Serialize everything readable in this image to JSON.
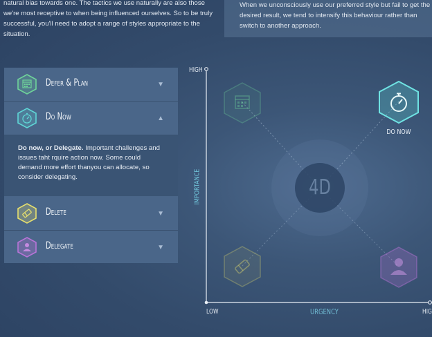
{
  "intro": {
    "left_text": "natural bias towards one. The tactics we use naturally are also those we're most receptive to when being influenced ourselves. So to be truly successful, you'll need to adopt a range of styles appropriate to the situation.",
    "right_text": "When we unconsciously use our preferred style but fail to get the desired result, we tend to intensify this behaviour rather than switch to another approach."
  },
  "accordion": {
    "items": [
      {
        "label": "Defer & Plan",
        "icon": "calendar-icon",
        "color": "#6fd49a",
        "arrow": "▼"
      },
      {
        "label": "Do Now",
        "icon": "stopwatch-icon",
        "color": "#5fd6d6",
        "arrow": "▲"
      },
      {
        "label": "Delete",
        "icon": "eraser-icon",
        "color": "#e6df6e",
        "arrow": "▼"
      },
      {
        "label": "Delegate",
        "icon": "person-icon",
        "color": "#b874d8",
        "arrow": "▼"
      }
    ],
    "expanded": {
      "title": "Do now, or Delegate.",
      "text": " Important challenges and issues taht rquire action now. Some could demand more effort thanyou can allocate, so consider delegating."
    }
  },
  "matrix": {
    "y_axis_top": "HIGH",
    "y_axis_label": "IMPORTANCE",
    "x_axis_left": "LOW",
    "x_axis_label": "URGENCY",
    "x_axis_right": "HIG",
    "center_label": "4D",
    "active_node_label": "DO NOW",
    "colors": {
      "defer": "#6fd49a",
      "do_now": "#5fd6d6",
      "delete": "#e6df6e",
      "delegate": "#b874d8"
    }
  }
}
